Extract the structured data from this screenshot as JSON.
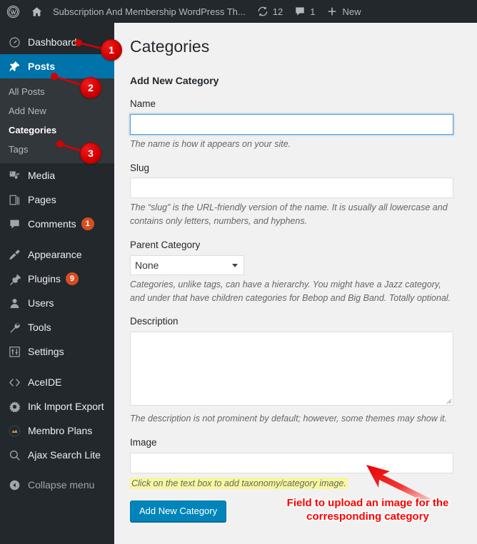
{
  "adminbar": {
    "logo_icon": "wordpress-logo-icon",
    "home_icon": "home-icon",
    "site_name": "Subscription And Membership WordPress Th...",
    "updates_icon": "updates-icon",
    "updates_count": "12",
    "comments_icon": "comment-bubble-icon",
    "comments_count": "1",
    "new_icon": "plus-icon",
    "new_label": "New"
  },
  "sidebar": {
    "items": [
      {
        "label": "Dashboard",
        "icon": "dashboard-icon",
        "name": "dashboard"
      },
      {
        "label": "Posts",
        "icon": "pin-icon",
        "name": "posts",
        "current": true
      },
      {
        "label": "Media",
        "icon": "media-icon",
        "name": "media"
      },
      {
        "label": "Pages",
        "icon": "pages-icon",
        "name": "pages"
      },
      {
        "label": "Comments",
        "icon": "comment-bubble-icon",
        "name": "comments",
        "badge": "1"
      },
      {
        "label": "Appearance",
        "icon": "paintbrush-icon",
        "name": "appearance"
      },
      {
        "label": "Plugins",
        "icon": "plug-icon",
        "name": "plugins",
        "badge": "9"
      },
      {
        "label": "Users",
        "icon": "user-icon",
        "name": "users"
      },
      {
        "label": "Tools",
        "icon": "wrench-icon",
        "name": "tools"
      },
      {
        "label": "Settings",
        "icon": "sliders-icon",
        "name": "settings"
      },
      {
        "label": "AceIDE",
        "icon": "code-brackets-icon",
        "name": "aceide"
      },
      {
        "label": "Ink Import Export",
        "icon": "gear-icon",
        "name": "ink-import-export"
      },
      {
        "label": "Membro Plans",
        "icon": "membro-badge-icon",
        "name": "membro-plans"
      },
      {
        "label": "Ajax Search Lite",
        "icon": "search-icon",
        "name": "ajax-search-lite"
      }
    ],
    "submenu": [
      {
        "label": "All Posts",
        "name": "all-posts"
      },
      {
        "label": "Add New",
        "name": "add-new"
      },
      {
        "label": "Categories",
        "name": "categories",
        "current": true
      },
      {
        "label": "Tags",
        "name": "tags"
      }
    ],
    "collapse": {
      "label": "Collapse menu",
      "icon": "collapse-arrow-icon"
    }
  },
  "main": {
    "page_title": "Categories",
    "form_heading": "Add New Category",
    "fields": {
      "name": {
        "label": "Name",
        "value": "",
        "help": "The name is how it appears on your site."
      },
      "slug": {
        "label": "Slug",
        "value": "",
        "help": "The “slug” is the URL-friendly version of the name. It is usually all lowercase and contains only letters, numbers, and hyphens."
      },
      "parent": {
        "label": "Parent Category",
        "selected": "None",
        "options": [
          "None"
        ],
        "help": "Categories, unlike tags, can have a hierarchy. You might have a Jazz category, and under that have children categories for Bebop and Big Band. Totally optional."
      },
      "description": {
        "label": "Description",
        "value": "",
        "help": "The description is not prominent by default; however, some themes may show it."
      },
      "image": {
        "label": "Image",
        "value": "",
        "help": "Click on the text box to add taxonomy/category image."
      }
    },
    "submit_label": "Add New Category"
  },
  "annotations": {
    "callouts": [
      {
        "number": "1",
        "name": "callout-marker-1"
      },
      {
        "number": "2",
        "name": "callout-marker-2"
      },
      {
        "number": "3",
        "name": "callout-marker-3"
      }
    ],
    "note": "Field to upload an image for the corresponding category",
    "arrow_icon": "red-arrow-icon"
  },
  "colors": {
    "sidebar_bg": "#23282d",
    "submenu_bg": "#32373c",
    "accent_blue": "#0073aa",
    "button_blue": "#0085ba",
    "badge_orange": "#d54e21",
    "highlight_yellow": "#f7f79e",
    "annotation_red": "#ff0000",
    "content_bg": "#f1f1f1"
  }
}
